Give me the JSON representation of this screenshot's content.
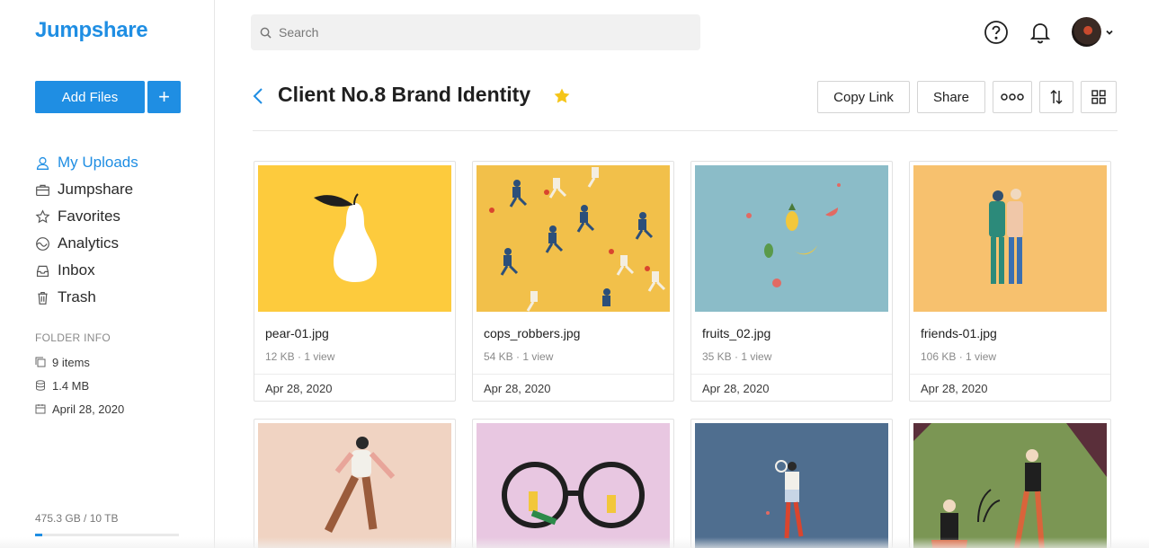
{
  "app": {
    "logo": "Jumpshare"
  },
  "sidebar": {
    "add_files_label": "Add Files",
    "add_plus_label": "+",
    "nav": [
      {
        "label": "My Uploads",
        "icon": "upload-user-icon",
        "active": true
      },
      {
        "label": "Jumpshare",
        "icon": "briefcase-icon",
        "active": false
      },
      {
        "label": "Favorites",
        "icon": "star-icon",
        "active": false
      },
      {
        "label": "Analytics",
        "icon": "analytics-icon",
        "active": false
      },
      {
        "label": "Inbox",
        "icon": "inbox-icon",
        "active": false
      },
      {
        "label": "Trash",
        "icon": "trash-icon",
        "active": false
      }
    ],
    "folder_info_title": "FOLDER INFO",
    "folder_info": [
      {
        "icon": "copy-icon",
        "text": "9 items"
      },
      {
        "icon": "database-icon",
        "text": "1.4 MB"
      },
      {
        "icon": "calendar-icon",
        "text": "April 28, 2020"
      }
    ],
    "storage_text": "475.3 GB / 10 TB",
    "storage_used_fraction": 0.05
  },
  "header": {
    "search_placeholder": "Search",
    "help_icon": "help-icon",
    "bell_icon": "bell-icon"
  },
  "folder": {
    "title": "Client No.8 Brand Identity",
    "starred": true,
    "actions": {
      "copy_link": "Copy Link",
      "share": "Share",
      "more": "more-icon",
      "sort": "sort-icon",
      "grid": "grid-icon"
    }
  },
  "files": [
    {
      "name": "pear-01.jpg",
      "meta": "12 KB · 1 view",
      "date": "Apr 28, 2020",
      "bg": "#fdcb3d"
    },
    {
      "name": "cops_robbers.jpg",
      "meta": "54 KB · 1 view",
      "date": "Apr 28, 2020",
      "bg": "#f2c04a"
    },
    {
      "name": "fruits_02.jpg",
      "meta": "35 KB · 1 view",
      "date": "Apr 28, 2020",
      "bg": "#8bbcc8"
    },
    {
      "name": "friends-01.jpg",
      "meta": "106 KB · 1 view",
      "date": "Apr 28, 2020",
      "bg": "#f7c16e"
    },
    {
      "bg": "#f0d3c2"
    },
    {
      "bg": "#e8c7e1"
    },
    {
      "bg": "#4f6e8f"
    },
    {
      "bg": "#7b9654"
    }
  ],
  "colors": {
    "accent": "#1f8ee3",
    "star": "#f5c518"
  }
}
